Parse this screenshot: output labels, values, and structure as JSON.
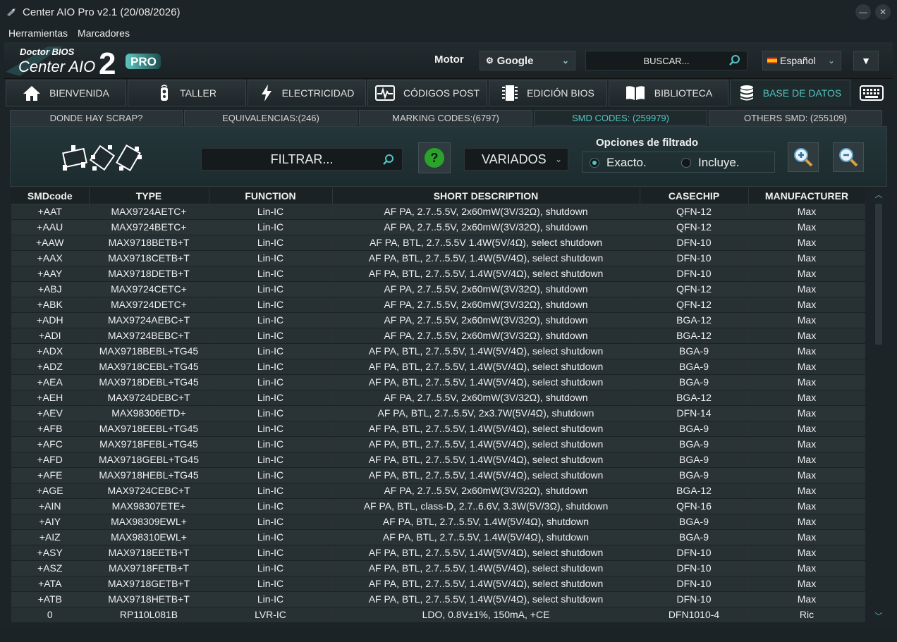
{
  "window": {
    "title": "Center AIO Pro v2.1 (20/08/2026)"
  },
  "menu": [
    "Herramientas",
    "Marcadores"
  ],
  "header": {
    "logo_top": "Doctor BIOS",
    "logo_main": "Center AIO",
    "logo_num": "2",
    "logo_badge": "PRO",
    "motor_label": "Motor",
    "engine": "Google",
    "search_placeholder": "BUSCAR...",
    "language": "Español"
  },
  "main_tabs": [
    {
      "label": "BIENVENIDA",
      "icon": "home-icon"
    },
    {
      "label": "TALLER",
      "icon": "remote-icon"
    },
    {
      "label": "ELECTRICIDAD",
      "icon": "lightning-icon"
    },
    {
      "label": "CÓDIGOS POST",
      "icon": "pulse-icon"
    },
    {
      "label": "EDICIÓN BIOS",
      "icon": "chip-icon"
    },
    {
      "label": "BIBLIOTECA",
      "icon": "book-icon"
    },
    {
      "label": "BASE DE DATOS",
      "icon": "database-icon",
      "active": true
    }
  ],
  "sub_tabs": [
    {
      "label": "DONDE HAY SCRAP?"
    },
    {
      "label": "EQUIVALENCIAS:(246)"
    },
    {
      "label": "MARKING CODES:(6797)"
    },
    {
      "label": "SMD CODES: (259979)",
      "active": true
    },
    {
      "label": "OTHERS SMD: (255109)"
    }
  ],
  "filter": {
    "placeholder": "FILTRAR...",
    "help": "?",
    "category": "VARIADOS",
    "options_title": "Opciones de filtrado",
    "option_exact": "Exacto.",
    "option_includes": "Incluye.",
    "selected": "exact"
  },
  "table": {
    "columns": [
      "SMDcode",
      "TYPE",
      "FUNCTION",
      "SHORT DESCRIPTION",
      "CASECHIP",
      "MANUFACTURER"
    ],
    "rows": [
      [
        "+AAT",
        "MAX9724AETC+",
        "Lin-IC",
        "AF PA, 2.7..5.5V, 2x60mW(3V/32Ω), shutdown",
        "QFN-12",
        "Max"
      ],
      [
        "+AAU",
        "MAX9724BETC+",
        "Lin-IC",
        "AF PA, 2.7..5.5V, 2x60mW(3V/32Ω), shutdown",
        "QFN-12",
        "Max"
      ],
      [
        "+AAW",
        "MAX9718BETB+T",
        "Lin-IC",
        "AF PA, BTL, 2.7..5.5V 1.4W(5V/4Ω), select shutdown",
        "DFN-10",
        "Max"
      ],
      [
        "+AAX",
        "MAX9718CETB+T",
        "Lin-IC",
        "AF PA, BTL, 2.7..5.5V, 1.4W(5V/4Ω), select shutdown",
        "DFN-10",
        "Max"
      ],
      [
        "+AAY",
        "MAX9718DETB+T",
        "Lin-IC",
        "AF PA, BTL, 2.7..5.5V, 1.4W(5V/4Ω), select shutdown",
        "DFN-10",
        "Max"
      ],
      [
        "+ABJ",
        "MAX9724CETC+",
        "Lin-IC",
        "AF PA, 2.7..5.5V, 2x60mW(3V/32Ω), shutdown",
        "QFN-12",
        "Max"
      ],
      [
        "+ABK",
        "MAX9724DETC+",
        "Lin-IC",
        "AF PA, 2.7..5.5V, 2x60mW(3V/32Ω), shutdown",
        "QFN-12",
        "Max"
      ],
      [
        "+ADH",
        "MAX9724AEBC+T",
        "Lin-IC",
        "AF PA, 2.7..5.5V, 2x60mW(3V/32Ω), shutdown",
        "BGA-12",
        "Max"
      ],
      [
        "+ADI",
        "MAX9724BEBC+T",
        "Lin-IC",
        "AF PA, 2.7..5.5V, 2x60mW(3V/32Ω), shutdown",
        "BGA-12",
        "Max"
      ],
      [
        "+ADX",
        "MAX9718BEBL+TG45",
        "Lin-IC",
        "AF PA, BTL, 2.7..5.5V, 1.4W(5V/4Ω), select shutdown",
        "BGA-9",
        "Max"
      ],
      [
        "+ADZ",
        "MAX9718CEBL+TG45",
        "Lin-IC",
        "AF PA, BTL, 2.7..5.5V, 1.4W(5V/4Ω), select shutdown",
        "BGA-9",
        "Max"
      ],
      [
        "+AEA",
        "MAX9718DEBL+TG45",
        "Lin-IC",
        "AF PA, BTL, 2.7..5.5V, 1.4W(5V/4Ω), select shutdown",
        "BGA-9",
        "Max"
      ],
      [
        "+AEH",
        "MAX9724DEBC+T",
        "Lin-IC",
        "AF PA, 2.7..5.5V, 2x60mW(3V/32Ω), shutdown",
        "BGA-12",
        "Max"
      ],
      [
        "+AEV",
        "MAX98306ETD+",
        "Lin-IC",
        "AF PA, BTL, 2.7..5.5V, 2x3.7W(5V/4Ω), shutdown",
        "DFN-14",
        "Max"
      ],
      [
        "+AFB",
        "MAX9718EEBL+TG45",
        "Lin-IC",
        "AF PA, BTL, 2.7..5.5V, 1.4W(5V/4Ω), select shutdown",
        "BGA-9",
        "Max"
      ],
      [
        "+AFC",
        "MAX9718FEBL+TG45",
        "Lin-IC",
        "AF PA, BTL, 2.7..5.5V, 1.4W(5V/4Ω), select shutdown",
        "BGA-9",
        "Max"
      ],
      [
        "+AFD",
        "MAX9718GEBL+TG45",
        "Lin-IC",
        "AF PA, BTL, 2.7..5.5V, 1.4W(5V/4Ω), select shutdown",
        "BGA-9",
        "Max"
      ],
      [
        "+AFE",
        "MAX9718HEBL+TG45",
        "Lin-IC",
        "AF PA, BTL, 2.7..5.5V, 1.4W(5V/4Ω), select shutdown",
        "BGA-9",
        "Max"
      ],
      [
        "+AGE",
        "MAX9724CEBC+T",
        "Lin-IC",
        "AF PA, 2.7..5.5V, 2x60mW(3V/32Ω), shutdown",
        "BGA-12",
        "Max"
      ],
      [
        "+AIN",
        "MAX98307ETE+",
        "Lin-IC",
        "AF PA, BTL, class-D, 2.7..6.6V, 3.3W(5V/3Ω), shutdown",
        "QFN-16",
        "Max"
      ],
      [
        "+AIY",
        "MAX98309EWL+",
        "Lin-IC",
        "AF PA, BTL, 2.7..5.5V, 1.4W(5V/4Ω), shutdown",
        "BGA-9",
        "Max"
      ],
      [
        "+AIZ",
        "MAX98310EWL+",
        "Lin-IC",
        "AF PA, BTL, 2.7..5.5V, 1.4W(5V/4Ω), shutdown",
        "BGA-9",
        "Max"
      ],
      [
        "+ASY",
        "MAX9718EETB+T",
        "Lin-IC",
        "AF PA, BTL, 2.7..5.5V, 1.4W(5V/4Ω), select shutdown",
        "DFN-10",
        "Max"
      ],
      [
        "+ASZ",
        "MAX9718FETB+T",
        "Lin-IC",
        "AF PA, BTL, 2.7..5.5V, 1.4W(5V/4Ω), select shutdown",
        "DFN-10",
        "Max"
      ],
      [
        "+ATA",
        "MAX9718GETB+T",
        "Lin-IC",
        "AF PA, BTL, 2.7..5.5V, 1.4W(5V/4Ω), select shutdown",
        "DFN-10",
        "Max"
      ],
      [
        "+ATB",
        "MAX9718HETB+T",
        "Lin-IC",
        "AF PA, BTL, 2.7..5.5V, 1.4W(5V/4Ω), select shutdown",
        "DFN-10",
        "Max"
      ],
      [
        "0",
        "RP110L081B",
        "LVR-IC",
        "LDO, 0.8V±1%, 150mA, +CE",
        "DFN1010-4",
        "Ric"
      ]
    ]
  },
  "colors": {
    "accent": "#52c5c1",
    "background": "#1c2427",
    "help_green": "#2aa32a"
  }
}
